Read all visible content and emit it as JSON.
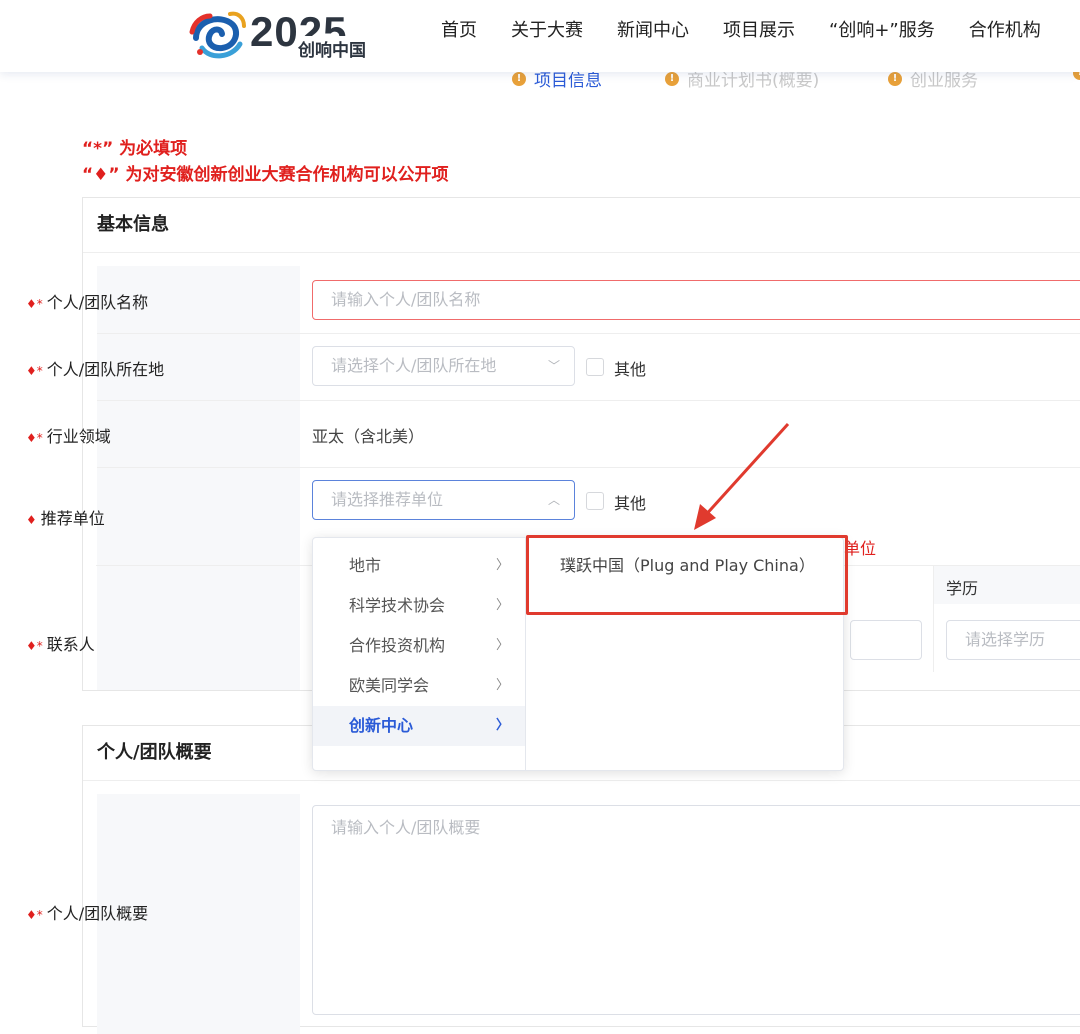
{
  "header": {
    "logo_year": "2025",
    "logo_subtitle": "创响中国",
    "nav": [
      "首页",
      "关于大赛",
      "新闻中心",
      "项目展示",
      "“创响+”服务",
      "合作机构"
    ]
  },
  "steps": [
    "项目信息",
    "商业计划书(概要)",
    "创业服务"
  ],
  "notes": {
    "required": "“*” 为必填项",
    "public": "“♦” 为对安徽创新创业大赛合作机构可以公开项"
  },
  "basic_info": {
    "title": "基本信息",
    "name_label": "个人/团队名称",
    "name_placeholder": "请输入个人/团队名称",
    "location_label": "个人/团队所在地",
    "location_placeholder": "请选择个人/团队所在地",
    "other_label": "其他",
    "industry_label": "行业领域",
    "industry_value": "亚太（含北美）",
    "recommend_label": "推荐单位",
    "recommend_placeholder": "请选择推荐单位",
    "recommend_hint_tail": "单位",
    "contact_label": "联系人",
    "education_label": "学历",
    "education_placeholder": "请选择学历"
  },
  "cascader": {
    "level1": [
      "地市",
      "科学技术协会",
      "合作投资机构",
      "欧美同学会",
      "创新中心"
    ],
    "level1_active_index": 4,
    "level2": [
      "璞跃中国（Plug and Play China）"
    ]
  },
  "summary": {
    "title": "个人/团队概要",
    "label": "个人/团队概要",
    "placeholder": "请输入个人/团队概要"
  },
  "colors": {
    "required_red": "#e0201e",
    "accent_blue": "#2b5bd7",
    "annotation_red": "#e03a2e"
  }
}
